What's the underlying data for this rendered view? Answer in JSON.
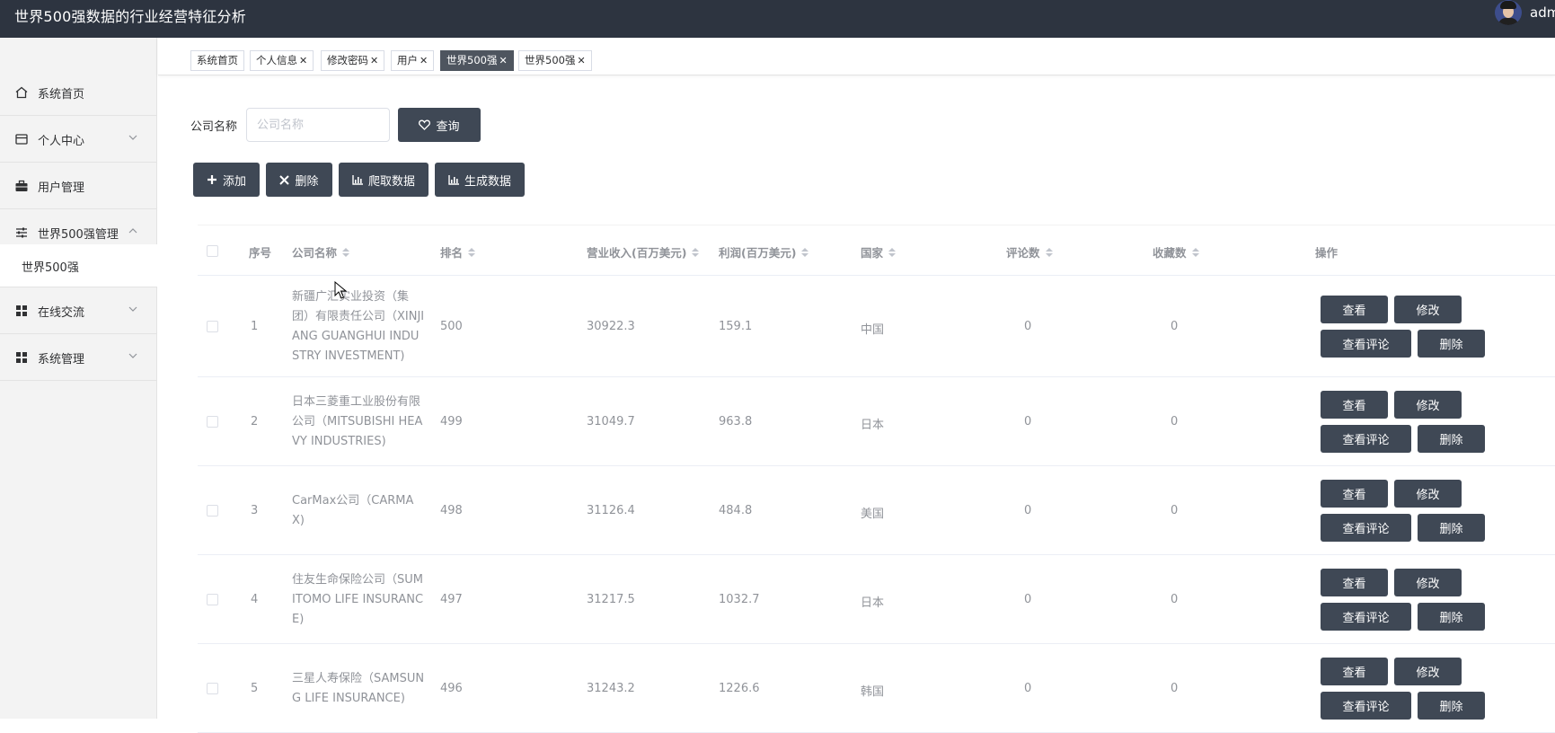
{
  "app": {
    "title": "世界500强数据的行业经营特征分析",
    "username": "admin"
  },
  "sidebar": {
    "items": [
      {
        "label": "系统首页",
        "icon": "home-icon",
        "expandable": false
      },
      {
        "label": "个人中心",
        "icon": "card-icon",
        "expandable": true
      },
      {
        "label": "用户管理",
        "icon": "briefcase-icon",
        "expandable": true
      },
      {
        "label": "世界500强管理",
        "icon": "sliders-icon",
        "expandable": true,
        "expanded": true
      },
      {
        "label": "在线交流",
        "icon": "grid-icon",
        "expandable": true
      },
      {
        "label": "系统管理",
        "icon": "grid-icon",
        "expandable": true
      }
    ],
    "subitem": "世界500强"
  },
  "tabs": [
    {
      "label": "系统首页",
      "closable": false
    },
    {
      "label": "个人信息",
      "closable": true
    },
    {
      "label": "修改密码",
      "closable": true
    },
    {
      "label": "用户",
      "closable": true
    },
    {
      "label": "世界500强",
      "closable": true,
      "active": true
    },
    {
      "label": "世界500强",
      "closable": true
    }
  ],
  "search": {
    "label": "公司名称",
    "placeholder": "公司名称",
    "value": "",
    "button": "查询"
  },
  "toolbar": {
    "add": "添加",
    "delete": "删除",
    "crawl": "爬取数据",
    "generate": "生成数据"
  },
  "table": {
    "headers": {
      "index": "序号",
      "name": "公司名称",
      "rank": "排名",
      "revenue": "营业收入(百万美元)",
      "profit": "利润(百万美元)",
      "country": "国家",
      "comments": "评论数",
      "favorites": "收藏数",
      "actions": "操作"
    },
    "rows": [
      {
        "index": "1",
        "name": "新疆广汇实业投资（集团）有限责任公司（XINJIANG GUANGHUI INDUSTRY INVESTMENT)",
        "rank": "500",
        "revenue": "30922.3",
        "profit": "159.1",
        "country": "中国",
        "comments": "0",
        "favorites": "0"
      },
      {
        "index": "2",
        "name": "日本三菱重工业股份有限公司（MITSUBISHI HEAVY INDUSTRIES)",
        "rank": "499",
        "revenue": "31049.7",
        "profit": "963.8",
        "country": "日本",
        "comments": "0",
        "favorites": "0"
      },
      {
        "index": "3",
        "name": "CarMax公司（CARMAX)",
        "rank": "498",
        "revenue": "31126.4",
        "profit": "484.8",
        "country": "美国",
        "comments": "0",
        "favorites": "0"
      },
      {
        "index": "4",
        "name": "住友生命保险公司（SUMITOMO LIFE INSURANCE)",
        "rank": "497",
        "revenue": "31217.5",
        "profit": "1032.7",
        "country": "日本",
        "comments": "0",
        "favorites": "0"
      },
      {
        "index": "5",
        "name": "三星人寿保险（SAMSUNG LIFE INSURANCE)",
        "rank": "496",
        "revenue": "31243.2",
        "profit": "1226.6",
        "country": "韩国",
        "comments": "0",
        "favorites": "0"
      }
    ],
    "actions": {
      "view": "查看",
      "edit": "修改",
      "view_comments": "查看评论",
      "delete": "删除"
    }
  },
  "colors": {
    "topbar": "#2d3440",
    "button": "#3f4855",
    "active_tab": "#4e555f",
    "sidebar": "#f3f3f3"
  }
}
